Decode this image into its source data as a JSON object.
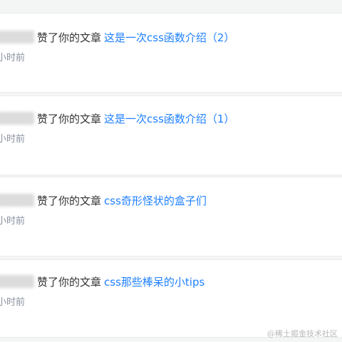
{
  "notifications": [
    {
      "action": "赞了你的文章",
      "article": "这是一次css函数介绍（2）",
      "time": "小时前"
    },
    {
      "action": "赞了你的文章",
      "article": "这是一次css函数介绍（1）",
      "time": "小时前"
    },
    {
      "action": "赞了你的文章",
      "article": "css奇形怪状的盒子们",
      "time": "小时前"
    },
    {
      "action": "赞了你的文章",
      "article": "css那些棒呆的小tips",
      "time": "小时前"
    }
  ],
  "watermark": "@稀土掘金技术社区"
}
